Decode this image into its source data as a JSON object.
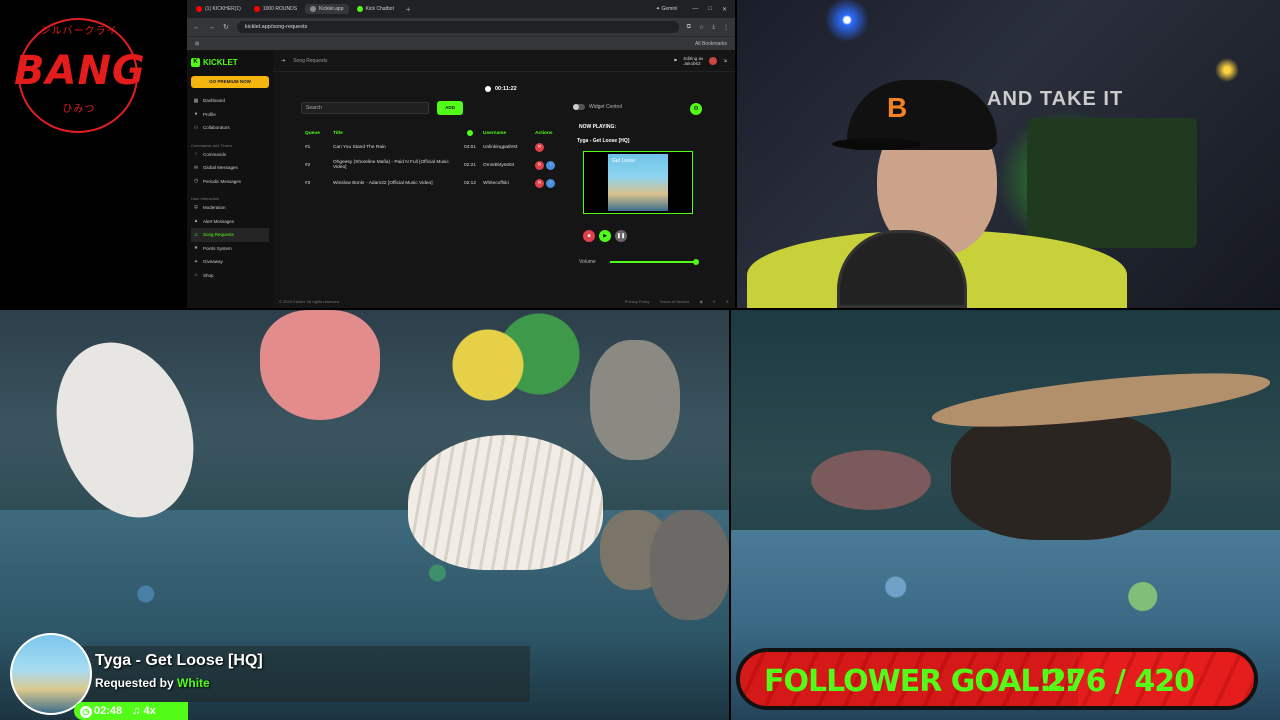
{
  "logo": {
    "text": "BANG",
    "arc_top": "シルバークライ",
    "arc_bottom": "ひみつ"
  },
  "browser": {
    "tabs": [
      {
        "label": "(1) KICKHER(1)",
        "color": "#ff0000"
      },
      {
        "label": "1000 ROUNDS",
        "color": "#ff0000"
      },
      {
        "label": "Kicklet.app",
        "color": "#888888",
        "active": true
      },
      {
        "label": "Kick Chatbot",
        "color": "#53fc18"
      }
    ],
    "new_tab": "+",
    "gemini": "✦ Gemini",
    "url": "kicklet.app/song-requests",
    "bookmarks_label": "All Bookmarks"
  },
  "app": {
    "brand": "KICKLET",
    "premium_button": "GO PREMIUM NOW",
    "sections": [
      {
        "items": [
          {
            "label": "Dashboard",
            "icon": "dashboard-icon"
          },
          {
            "label": "Profile",
            "icon": "user-icon"
          },
          {
            "label": "Collaborators",
            "icon": "team-icon"
          }
        ]
      },
      {
        "title": "Commands and Timers",
        "items": [
          {
            "label": "Commands",
            "icon": "command-icon"
          },
          {
            "label": "Global Messages",
            "icon": "message-icon"
          },
          {
            "label": "Periodic Messages",
            "icon": "clock-icon"
          }
        ]
      },
      {
        "title": "User Interaction",
        "items": [
          {
            "label": "Moderation",
            "icon": "shield-icon"
          },
          {
            "label": "Alert Messages",
            "icon": "alert-icon"
          },
          {
            "label": "Song Requests",
            "icon": "music-icon",
            "active": true
          },
          {
            "label": "Points System",
            "icon": "star-icon"
          },
          {
            "label": "Giveaway",
            "icon": "gift-icon"
          },
          {
            "label": "Shop",
            "icon": "shop-icon"
          }
        ]
      }
    ],
    "page_title": "Song Requests",
    "editing_as": "Editing as",
    "editing_user": "Jakob63",
    "timer": "00:11:22",
    "search_placeholder": "Search",
    "add_button": "ADD",
    "queue_headers": {
      "queue": "Queue",
      "title": "Title",
      "username": "Username",
      "actions": "Actions"
    },
    "queue": [
      {
        "pos": "#1",
        "title": "Can You Stand The Rain",
        "duration": "04:01",
        "user": "Unlinkingpath93"
      },
      {
        "pos": "#2",
        "title": "Ohgeesy (Shoreline Mafia) - Paid N Full [Official Music Video]",
        "duration": "02:21",
        "user": "OmniBl4ys604"
      },
      {
        "pos": "#3",
        "title": "Winslow Bonkr - Adam22 [Official Music Video]",
        "duration": "02:12",
        "user": "Whitecoffski"
      }
    ],
    "widget_control": "Widget Control",
    "now_playing_label": "NOW PLAYING:",
    "now_playing_track": "Tyga - Get Loose [HQ]",
    "thumb_text": "Get Loose",
    "volume_label": "Volume",
    "footer_copy": "© 2025 Kicklet. All rights reserved.",
    "footer_links": [
      "Privacy Policy",
      "Terms of Service"
    ]
  },
  "webcam": {
    "banner": "AND TAKE IT",
    "cap_logo": "B"
  },
  "overlay": {
    "track": "Tyga - Get Loose [HQ]",
    "requested_by": "Requested by",
    "requester": "White",
    "elapsed": "02:48",
    "queue_count": "4x"
  },
  "goal": {
    "label": "FOLLOWER GOAL!!!",
    "current": 276,
    "target": 420,
    "count_text": "276 / 420"
  }
}
